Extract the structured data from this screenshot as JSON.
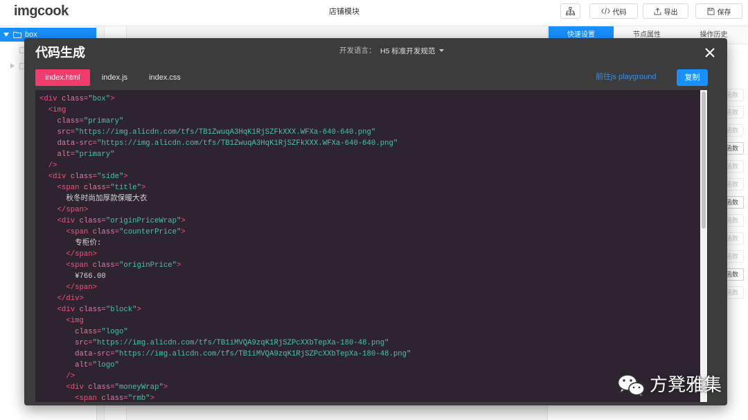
{
  "header": {
    "logo_text": "imgcook",
    "page_title": "店铺模块",
    "toolbar": {
      "tree_icon": "sitemap-icon",
      "code_icon": "code-icon",
      "code_label": "代码",
      "export_icon": "export-icon",
      "export_label": "导出",
      "save_icon": "save-icon",
      "save_label": "保存"
    }
  },
  "left_panel": {
    "tree": [
      {
        "label": "box",
        "expanded": true,
        "selected": true,
        "icon": "folder-icon"
      }
    ]
  },
  "right_panel": {
    "tabs": [
      {
        "label": "快速设置",
        "active": true
      },
      {
        "label": "节点属性",
        "active": false
      },
      {
        "label": "操作历史",
        "active": false
      }
    ],
    "function_buttons": [
      {
        "label": "函数",
        "emphasis": false
      },
      {
        "label": "函数",
        "emphasis": false
      },
      {
        "label": "函数",
        "emphasis": false
      },
      {
        "label": "函数",
        "emphasis": true
      },
      {
        "label": "函数",
        "emphasis": false
      },
      {
        "label": "函数",
        "emphasis": false
      },
      {
        "label": "函数",
        "emphasis": true
      },
      {
        "label": "函数",
        "emphasis": false
      },
      {
        "label": "函数",
        "emphasis": false
      },
      {
        "label": "函数",
        "emphasis": false
      },
      {
        "label": "函数",
        "emphasis": true
      },
      {
        "label": "函数",
        "emphasis": false
      }
    ]
  },
  "modal": {
    "title": "代码生成",
    "language_label": "开发语言：",
    "language_value": "H5 标准开发规范",
    "tabs": [
      {
        "label": "index.html",
        "active": true
      },
      {
        "label": "index.js",
        "active": false
      },
      {
        "label": "index.css",
        "active": false
      }
    ],
    "playground_link": "前往js playground",
    "copy_label": "复制",
    "code": {
      "lines": [
        "<div class=\"box\">",
        "  <img",
        "    class=\"primary\"",
        "    src=\"https://img.alicdn.com/tfs/TB1ZwuqA3HqK1RjSZFkXXX.WFXa-640-640.png\"",
        "    data-src=\"https://img.alicdn.com/tfs/TB1ZwuqA3HqK1RjSZFkXXX.WFXa-640-640.png\"",
        "    alt=\"primary\"",
        "  />",
        "  <div class=\"side\">",
        "    <span class=\"title\">",
        "      秋冬时尚加厚款保暖大衣",
        "    </span>",
        "    <div class=\"originPriceWrap\">",
        "      <span class=\"counterPrice\">",
        "        专柜价:",
        "      </span>",
        "      <span class=\"originPrice\">",
        "        ¥766.00",
        "      </span>",
        "    </div>",
        "    <div class=\"block\">",
        "      <img",
        "        class=\"logo\"",
        "        src=\"https://img.alicdn.com/tfs/TB1iMVQA9zqK1RjSZPcXXbTepXa-180-48.png\"",
        "        data-src=\"https://img.alicdn.com/tfs/TB1iMVQA9zqK1RjSZPcXXbTepXa-180-48.png\"",
        "        alt=\"logo\"",
        "      />",
        "      <div class=\"moneyWrap\">",
        "        <span class=\"rmb\">"
      ]
    }
  },
  "watermark": {
    "text": "方凳雅集",
    "icon": "wechat-icon"
  },
  "colors": {
    "accent": "#1890ff",
    "active_tab": "#f23c6e",
    "modal_bg": "#3c3c3c",
    "code_bg": "#2d2430",
    "link": "#3d8fe8",
    "syntax_tag": "#f6527a",
    "syntax_attr": "#e07fa0",
    "syntax_string": "#4cc3a3",
    "syntax_text": "#d6d6d6"
  }
}
